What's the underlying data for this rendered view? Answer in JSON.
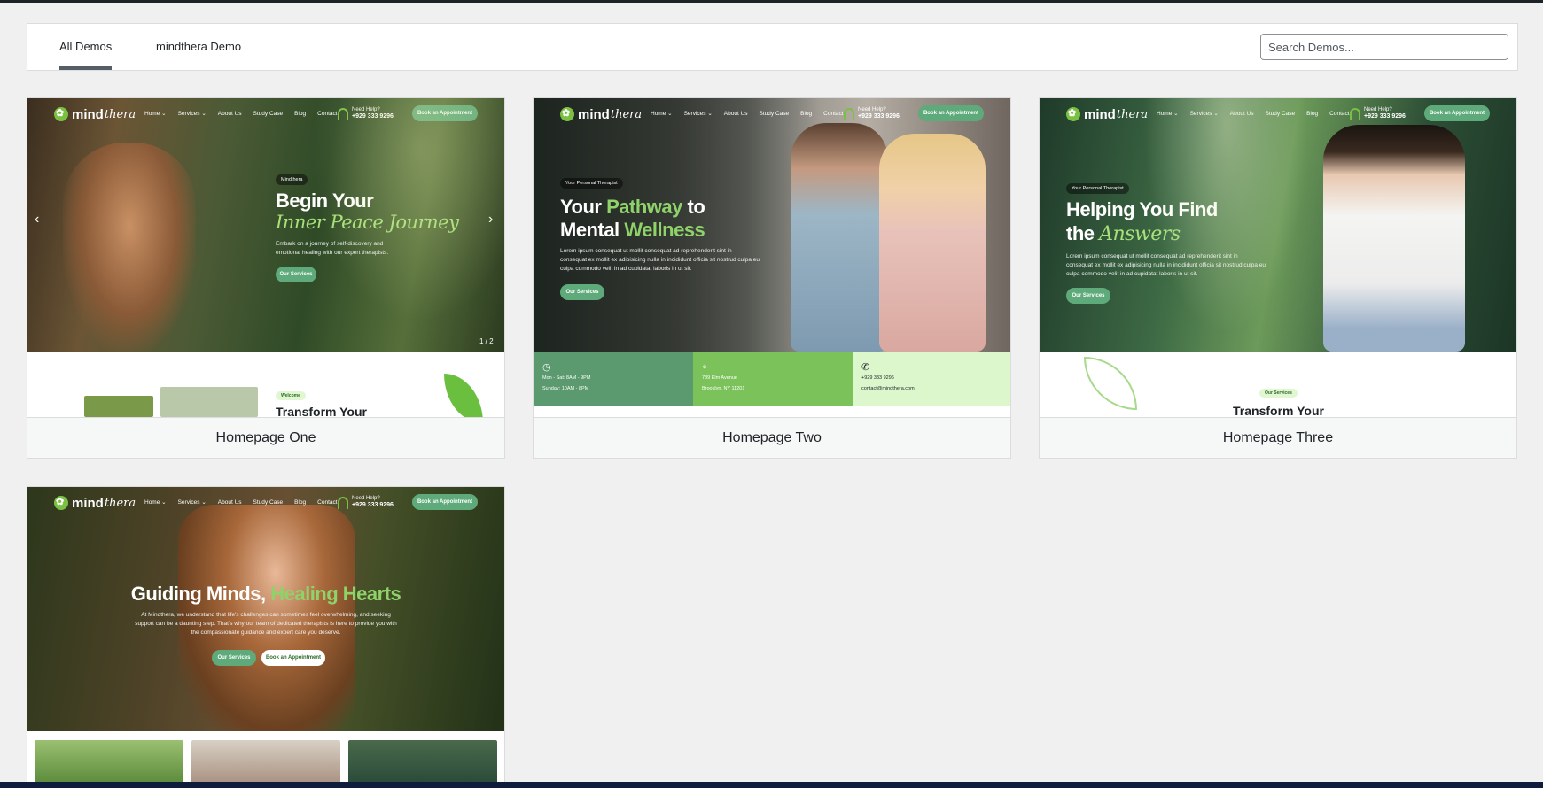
{
  "tabs": [
    {
      "label": "All Demos",
      "active": true
    },
    {
      "label": "mindthera Demo",
      "active": false
    }
  ],
  "search": {
    "placeholder": "Search Demos..."
  },
  "site": {
    "logo_text": "mind",
    "logo_script": "thera",
    "nav": [
      "Home ⌄",
      "Services ⌄",
      "About Us",
      "Study Case",
      "Blog",
      "Contact"
    ],
    "help_label": "Need Help?",
    "phone": "+929 333 9296",
    "book_label": "Book an Appointment",
    "services_label": "Our Services",
    "lorem": "Lorem ipsum consequat ut mollit consequat ad reprehenderit sint in consequat ex mollit ex adipisicing nulla in incididunt officia sit nostrud culpa eu culpa commodo velit in ad cupidatat laboris in ut sit."
  },
  "demos": [
    {
      "name": "Homepage One",
      "tag": "Mindthera",
      "heading_line1": "Begin Your",
      "heading_script": "Inner Peace Journey",
      "text": "Embark on a journey of self-discovery and emotional healing with our expert therapists.",
      "counter": "1 / 2",
      "welcome": "Welcome",
      "lower_title": "Transform Your"
    },
    {
      "name": "Homepage Two",
      "tag": "Your Personal Therapist",
      "heading_a": "Your",
      "heading_b": "Pathway",
      "heading_c": "to",
      "heading_d": "Mental",
      "heading_e": "Wellness",
      "hours1": "Mon - Sat: 8AM - 9PM",
      "hours2": "Sunday: 10AM - 8PM",
      "address1": "789 Elm Avenue",
      "address2": "Brooklyn, NY 11201",
      "phone": "+929 333 9296",
      "email": "contact@mindthera.com"
    },
    {
      "name": "Homepage Three",
      "tag": "Your Personal Therapist",
      "heading_line1": "Helping You Find",
      "heading_the": "the",
      "heading_script": "Answers",
      "services_tag": "Our Services",
      "lower_title": "Transform Your"
    },
    {
      "heading_a": "Guiding Minds,",
      "heading_b": "Healing Hearts",
      "text": "At Mindthera, we understand that life's challenges can sometimes feel overwhelming, and seeking support can be a daunting step. That's why our team of dedicated therapists is here to provide you with the compassionate guidance and expert care you deserve."
    }
  ],
  "colors": {
    "accent_green": "#7ac142",
    "button_green": "#5faa7a",
    "tab_underline": "#555d66",
    "info_dark": "#5a9a6e",
    "info_mid": "#7cc25a",
    "info_light": "#dcf7cc"
  }
}
